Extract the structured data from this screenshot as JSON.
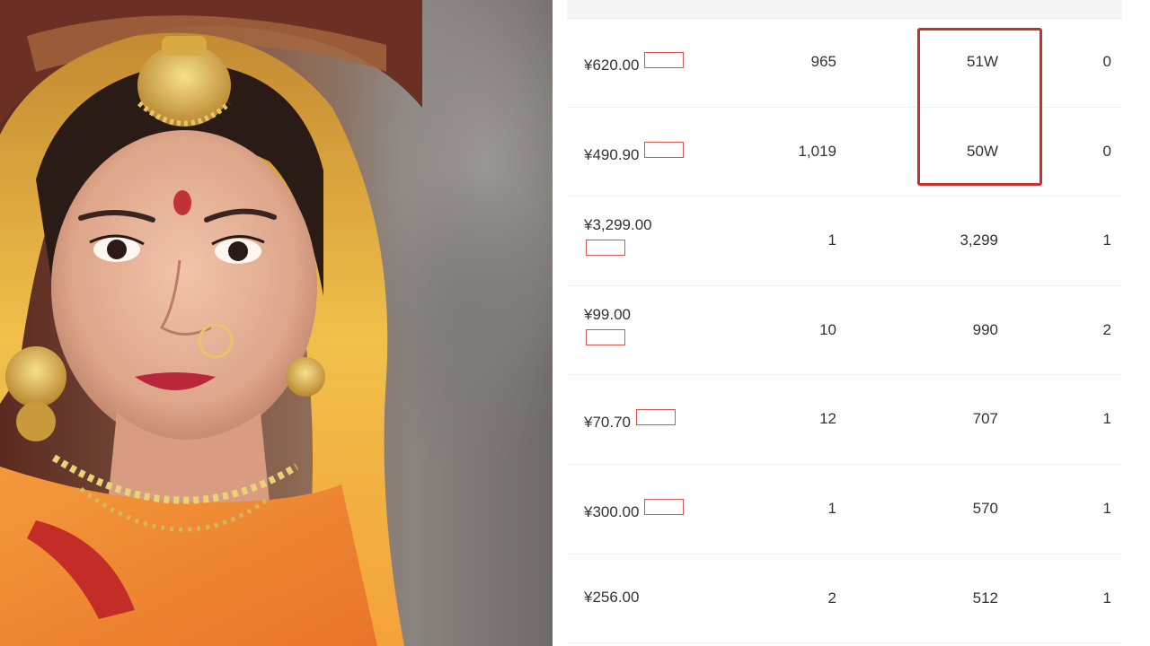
{
  "photo": {
    "icon": "portrait-photo"
  },
  "table": {
    "columns": [
      "",
      "",
      "",
      ""
    ],
    "rows": [
      {
        "price": "¥620.00",
        "tag": "",
        "qty": "965",
        "amount": "51W",
        "last": "0"
      },
      {
        "price": "¥490.90",
        "tag": "",
        "qty": "1,019",
        "amount": "50W",
        "last": "0"
      },
      {
        "price": "¥3,299.00",
        "tag": "",
        "qty": "1",
        "amount": "3,299",
        "last": "1"
      },
      {
        "price": "¥99.00",
        "tag": "",
        "qty": "10",
        "amount": "990",
        "last": "2"
      },
      {
        "price": "¥70.70",
        "tag": "",
        "qty": "12",
        "amount": "707",
        "last": "1"
      },
      {
        "price": "¥300.00",
        "tag": "",
        "qty": "1",
        "amount": "570",
        "last": "1"
      },
      {
        "price": "¥256.00",
        "tag": "",
        "qty": "2",
        "amount": "512",
        "last": "1"
      }
    ]
  },
  "colors": {
    "highlight": "#c9302c",
    "tag": "#d9534f"
  }
}
